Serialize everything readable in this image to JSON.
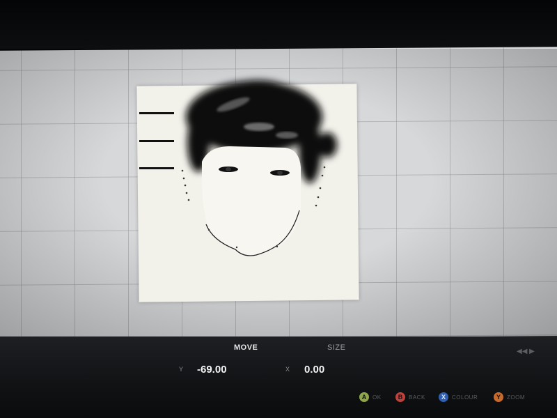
{
  "editor": {
    "tabs": {
      "move": "MOVE",
      "size": "SIZE"
    },
    "fields": {
      "y_label": "Y",
      "y_value": "-69.00",
      "x_label": "X",
      "x_value": "0.00"
    }
  },
  "controller_hints": [
    {
      "button": "A",
      "label": "OK",
      "color": "#8fa64a"
    },
    {
      "button": "B",
      "label": "BACK",
      "color": "#c0413c"
    },
    {
      "button": "X",
      "label": "COLOUR",
      "color": "#2f5fb0"
    },
    {
      "button": "Y",
      "label": "ZOOM",
      "color": "#c76a2a"
    }
  ],
  "nav_arrows": "◀◀ ▶",
  "icons": {
    "face_sketch": "face-sketch-icon"
  }
}
